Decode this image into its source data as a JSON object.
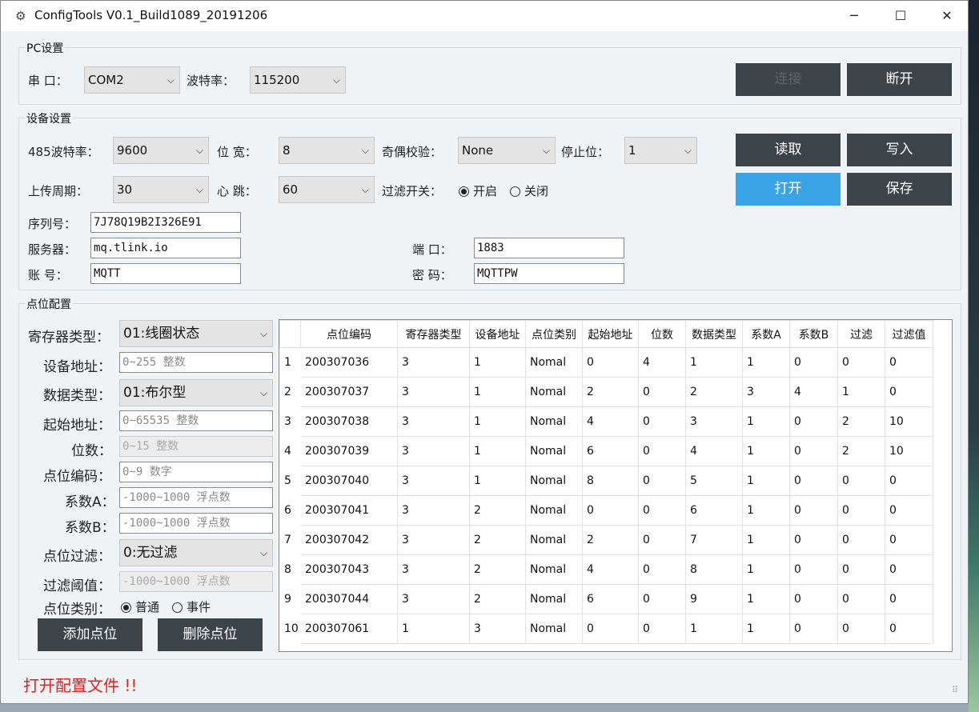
{
  "window": {
    "title": "ConfigTools V0.1_Build1089_20191206",
    "minimize": "─",
    "maximize": "☐",
    "close": "✕",
    "app_icon": "gear-icon"
  },
  "pc": {
    "group_label": "PC设置",
    "port_label": "串  口：",
    "port_value": "COM2",
    "baud_label": "波特率：",
    "baud_value": "115200",
    "connect": "连接",
    "disconnect": "断开"
  },
  "device": {
    "group_label": "设备设置",
    "baud485_label": "485波特率：",
    "baud485_value": "9600",
    "width_label": "位  宽：",
    "width_value": "8",
    "parity_label": "奇偶校验：",
    "parity_value": "None",
    "stop_label": "停止位：",
    "stop_value": "1",
    "upload_label": "上传周期：",
    "upload_value": "30",
    "heartbeat_label": "心  跳：",
    "heartbeat_value": "60",
    "filter_label": "过滤开关：",
    "filter_on": "开启",
    "filter_off": "关闭",
    "serial_label": "序列号：",
    "serial_value": "7J78Q19B2I326E91",
    "server_label": "服务器：",
    "server_value": "mq.tlink.io",
    "port_label": "端  口：",
    "port_value": "1883",
    "account_label": "账  号：",
    "account_value": "MQTT",
    "password_label": "密  码：",
    "password_value": "MQTTPW",
    "read": "读取",
    "write": "写入",
    "open": "打开",
    "save": "保存"
  },
  "points": {
    "group_label": "点位配置",
    "reg_type_label": "寄存器类型：",
    "reg_type_value": "01:线圈状态",
    "dev_addr_label": "设备地址：",
    "dev_addr_ph": "0~255 整数",
    "data_type_label": "数据类型：",
    "data_type_value": "01:布尔型",
    "start_addr_label": "起始地址：",
    "start_addr_ph": "0~65535 整数",
    "bits_label": "位数：",
    "bits_ph": "0~15 整数",
    "code_label": "点位编码：",
    "code_ph": "0~9 数字",
    "coefA_label": "系数A：",
    "coefA_ph": "-1000~1000 浮点数",
    "coefB_label": "系数B：",
    "coefB_ph": "-1000~1000 浮点数",
    "filter_label": "点位过滤：",
    "filter_value": "0:无过滤",
    "threshold_label": "过滤阈值：",
    "threshold_ph": "-1000~1000 浮点数",
    "category_label": "点位类别：",
    "cat_normal": "普通",
    "cat_event": "事件",
    "add": "添加点位",
    "delete": "删除点位",
    "columns": [
      "点位编码",
      "寄存器类型",
      "设备地址",
      "点位类别",
      "起始地址",
      "位数",
      "数据类型",
      "系数A",
      "系数B",
      "过滤",
      "过滤值"
    ],
    "rows": [
      [
        "1",
        "200307036",
        "3",
        "1",
        "Nomal",
        "0",
        "4",
        "1",
        "1",
        "0",
        "0",
        "0"
      ],
      [
        "2",
        "200307037",
        "3",
        "1",
        "Nomal",
        "2",
        "0",
        "2",
        "3",
        "4",
        "1",
        "0"
      ],
      [
        "3",
        "200307038",
        "3",
        "1",
        "Nomal",
        "4",
        "0",
        "3",
        "1",
        "0",
        "2",
        "10"
      ],
      [
        "4",
        "200307039",
        "3",
        "1",
        "Nomal",
        "6",
        "0",
        "4",
        "1",
        "0",
        "2",
        "10"
      ],
      [
        "5",
        "200307040",
        "3",
        "1",
        "Nomal",
        "8",
        "0",
        "5",
        "1",
        "0",
        "0",
        "0"
      ],
      [
        "6",
        "200307041",
        "3",
        "2",
        "Nomal",
        "0",
        "0",
        "6",
        "1",
        "0",
        "0",
        "0"
      ],
      [
        "7",
        "200307042",
        "3",
        "2",
        "Nomal",
        "2",
        "0",
        "7",
        "1",
        "0",
        "0",
        "0"
      ],
      [
        "8",
        "200307043",
        "3",
        "2",
        "Nomal",
        "4",
        "0",
        "8",
        "1",
        "0",
        "0",
        "0"
      ],
      [
        "9",
        "200307044",
        "3",
        "2",
        "Nomal",
        "6",
        "0",
        "9",
        "1",
        "0",
        "0",
        "0"
      ],
      [
        "10",
        "200307061",
        "1",
        "3",
        "Nomal",
        "0",
        "0",
        "1",
        "1",
        "0",
        "0",
        "0"
      ]
    ]
  },
  "status_text": "打开配置文件 !!"
}
